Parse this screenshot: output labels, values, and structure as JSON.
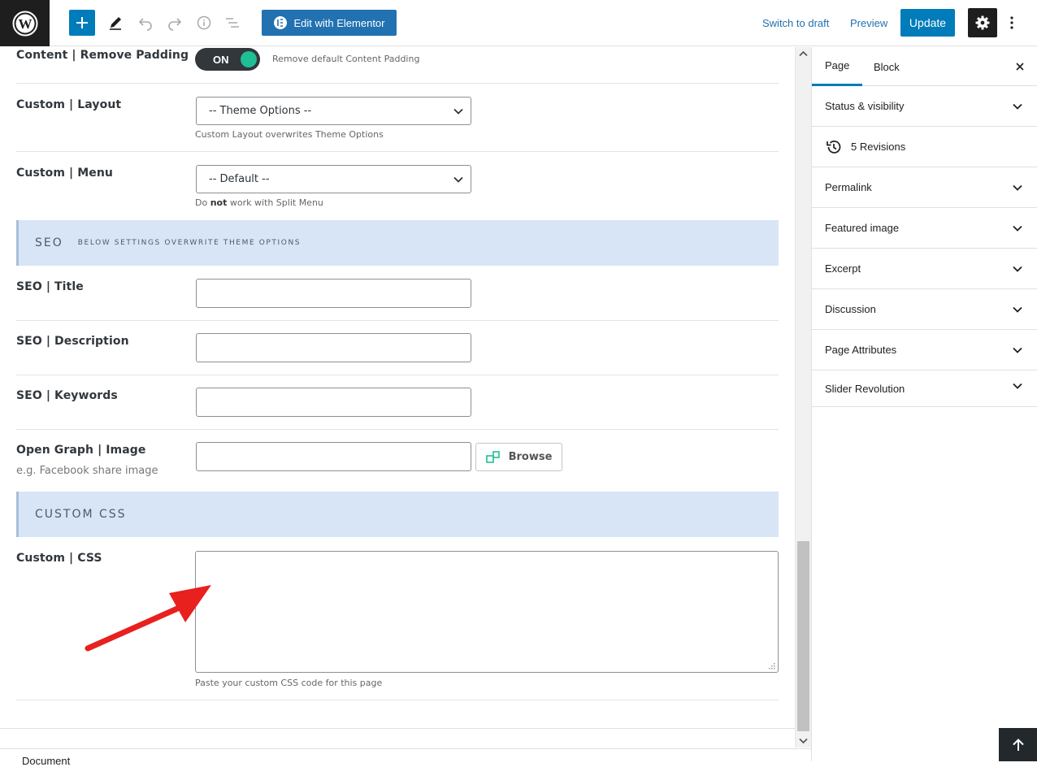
{
  "toolbar": {
    "elementor_label": "Edit with Elementor",
    "switch_draft": "Switch to draft",
    "preview": "Preview",
    "update": "Update"
  },
  "fields": {
    "remove_padding": {
      "label": "Content | Remove Padding",
      "toggle": "ON",
      "help": "Remove default Content Padding"
    },
    "layout": {
      "label": "Custom | Layout",
      "value": "-- Theme Options --",
      "help": "Custom Layout overwrites Theme Options"
    },
    "menu": {
      "label": "Custom | Menu",
      "value": "-- Default --",
      "help_pre": "Do ",
      "help_bold": "not",
      "help_post": " work with Split Menu"
    },
    "seo_section": {
      "title": "SEO",
      "subtitle": "BELOW SETTINGS OVERWRITE THEME OPTIONS"
    },
    "seo_title": {
      "label": "SEO | Title",
      "value": ""
    },
    "seo_description": {
      "label": "SEO | Description",
      "value": ""
    },
    "seo_keywords": {
      "label": "SEO | Keywords",
      "value": ""
    },
    "og_image": {
      "label": "Open Graph | Image",
      "sublabel": "e.g. Facebook share image",
      "value": "",
      "browse": "Browse"
    },
    "css_section": {
      "title": "CUSTOM CSS"
    },
    "custom_css": {
      "label": "Custom | CSS",
      "value": "",
      "help": "Paste your custom CSS code for this page"
    }
  },
  "sidebar": {
    "tabs": [
      "Page",
      "Block"
    ],
    "panels": [
      "Status & visibility",
      "5 Revisions",
      "Permalink",
      "Featured image",
      "Excerpt",
      "Discussion",
      "Page Attributes",
      "Slider Revolution"
    ]
  },
  "footer": {
    "label": "Document"
  },
  "colors": {
    "accent": "#007cba",
    "toggle_on": "#1fbf95",
    "section_bg": "#d8e5f7",
    "arrow": "#e8201e"
  }
}
